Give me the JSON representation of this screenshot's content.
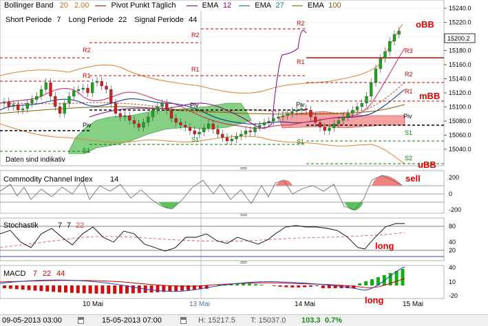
{
  "header": {
    "row1": [
      {
        "text": "Bollinger Band",
        "color": "#000000"
      },
      {
        "text": "20",
        "color": "#c07020"
      },
      {
        "text": "2.00",
        "color": "#c07020"
      },
      {
        "text": "Pivot Punkt Täglich",
        "color": "#000000"
      },
      {
        "text": "EMA",
        "color": "#000000"
      },
      {
        "text": "12",
        "color": "#800080"
      },
      {
        "text": "EMA",
        "color": "#000000"
      },
      {
        "text": "27",
        "color": "#008080"
      },
      {
        "text": "EMA",
        "color": "#000000"
      },
      {
        "text": "100",
        "color": "#806000"
      }
    ],
    "row2": [
      {
        "text": "Short Periode",
        "color": "#000000"
      },
      {
        "text": "7",
        "color": "#000000"
      },
      {
        "text": "Long Periode",
        "color": "#000000"
      },
      {
        "text": "22",
        "color": "#000000"
      },
      {
        "text": "Signal Periode",
        "color": "#000000"
      },
      {
        "text": "44",
        "color": "#000000"
      }
    ]
  },
  "price_axis": [
    "15240.0",
    "15220.0",
    "15200.0",
    "15180.0",
    "15160.0",
    "15140.0",
    "15120.0",
    "15100.0",
    "15080.0",
    "15060.0",
    "15040.0"
  ],
  "last_price": "15200.2",
  "pivot_labels": {
    "left": [
      "R2",
      "R1",
      "Piv",
      "S1"
    ],
    "mid": [
      "R2",
      "R1",
      "Piv",
      "S1"
    ],
    "right": [
      "R3",
      "R2",
      "R1",
      "Piv",
      "S1",
      "S2"
    ]
  },
  "annotations": {
    "obb": "oBB",
    "mbb": "mBB",
    "ubb": "uBB",
    "sell": "sell",
    "long_stoch": "long",
    "long_macd": "long",
    "indicative": "Daten sind indikativ"
  },
  "colors": {
    "annotation_red": "#e00000",
    "ema12": "#800080",
    "ema27": "#008080",
    "ema100": "#806000",
    "bollinger": "#e08030",
    "pivot": "#cc0000",
    "support": "#008000",
    "cloud": "#4caf50"
  },
  "cci": {
    "title": "Commodity Channel Index",
    "period": "14",
    "axis": [
      "200",
      "0",
      "-200"
    ]
  },
  "stoch": {
    "title": "Stochastik",
    "p1": "7",
    "p2": "7",
    "p3": "22",
    "axis": [
      "80",
      "40",
      "20"
    ]
  },
  "macd": {
    "title": "MACD",
    "p1": "7",
    "p2": "22",
    "p3": "44",
    "axis": [
      "40",
      "10",
      "-20"
    ]
  },
  "dates": [
    "10 Mai",
    "13 Mai",
    "14 Mai",
    "15 Mai"
  ],
  "status": {
    "from": "09-05-2013 03:00",
    "to": "15-05-2013 07:00",
    "high": "H: 15217.5",
    "low": "T: 15037.0",
    "change": "103.3",
    "change_pct": "0.7%"
  }
}
